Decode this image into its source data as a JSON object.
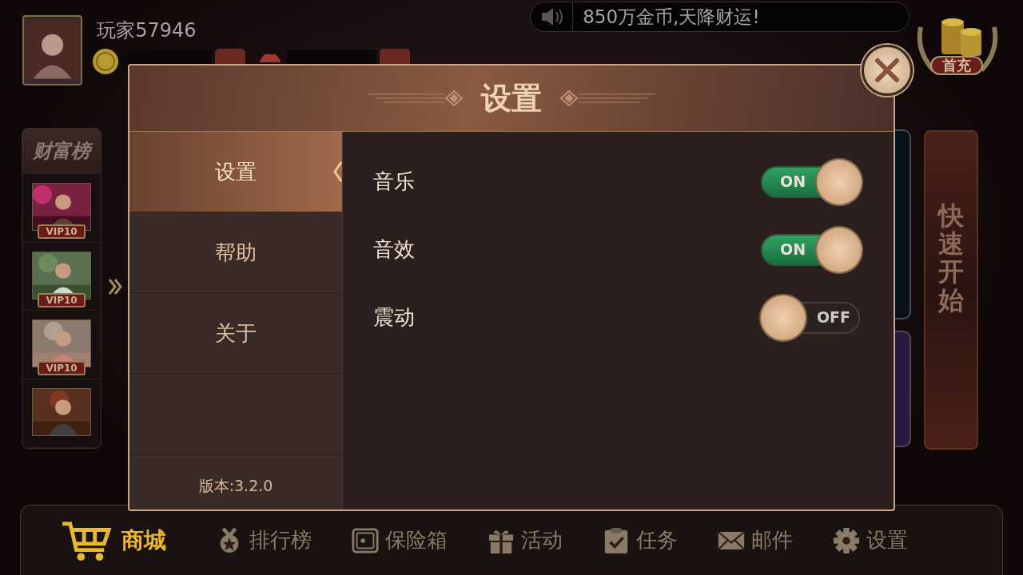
{
  "player": {
    "name": "玩家57946"
  },
  "marquee": {
    "text": "850万金币,天降财运!"
  },
  "first_charge": {
    "label": "首充"
  },
  "wealth_rank": {
    "title": "财富榜",
    "entries": [
      {
        "kind": "picture",
        "badge": "VIP10"
      },
      {
        "kind": "picture",
        "badge": "VIP10"
      },
      {
        "kind": "picture",
        "badge": "VIP10"
      },
      {
        "kind": "picture"
      }
    ]
  },
  "quick_start": {
    "label": "快速开始"
  },
  "dialog": {
    "title": "设置",
    "tabs": [
      {
        "label": "设置",
        "selected": true
      },
      {
        "label": "帮助",
        "selected": false
      },
      {
        "label": "关于",
        "selected": false
      }
    ],
    "version": "版本:3.2.0",
    "settings": [
      {
        "label": "音乐",
        "on": true,
        "state_text": "ON"
      },
      {
        "label": "音效",
        "on": true,
        "state_text": "ON"
      },
      {
        "label": "震动",
        "on": false,
        "state_text": "OFF"
      }
    ]
  },
  "bottom_nav": [
    {
      "label": "商城",
      "kind": "shop"
    },
    {
      "label": "排行榜",
      "kind": "rank"
    },
    {
      "label": "保险箱",
      "kind": "safe"
    },
    {
      "label": "活动",
      "kind": "gift"
    },
    {
      "label": "任务",
      "kind": "task"
    },
    {
      "label": "邮件",
      "kind": "mail"
    },
    {
      "label": "设置",
      "kind": "settings"
    }
  ]
}
